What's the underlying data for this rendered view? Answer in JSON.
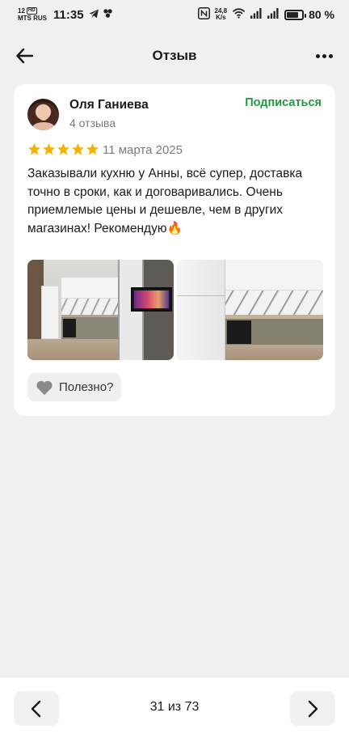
{
  "status_bar": {
    "network_tag": "HD",
    "signal_prefix": "12",
    "carrier": "MTS RUS",
    "time": "11:35",
    "speed_value": "24,8",
    "speed_unit": "K/s",
    "battery_percent": "80 %",
    "battery_level": 0.8
  },
  "header": {
    "title": "Отзыв"
  },
  "review": {
    "user_name": "Оля Ганиева",
    "user_reviews_count": "4 отзыва",
    "subscribe_label": "Подписаться",
    "rating": 5,
    "rating_max": 5,
    "date": "11 марта 2025",
    "text": "Заказывали кухню у Анны, всё супер, доставка точно в сроки, как и договаривались. Очень приемлемые цены и дешевле, чем в других магазинах! Рекомендую🔥",
    "helpful_label": "Полезно?"
  },
  "pager": {
    "label": "31 из 73"
  },
  "colors": {
    "subscribe": "#1f9a3c",
    "star": "#f5b300",
    "background": "#f0f0f0"
  }
}
